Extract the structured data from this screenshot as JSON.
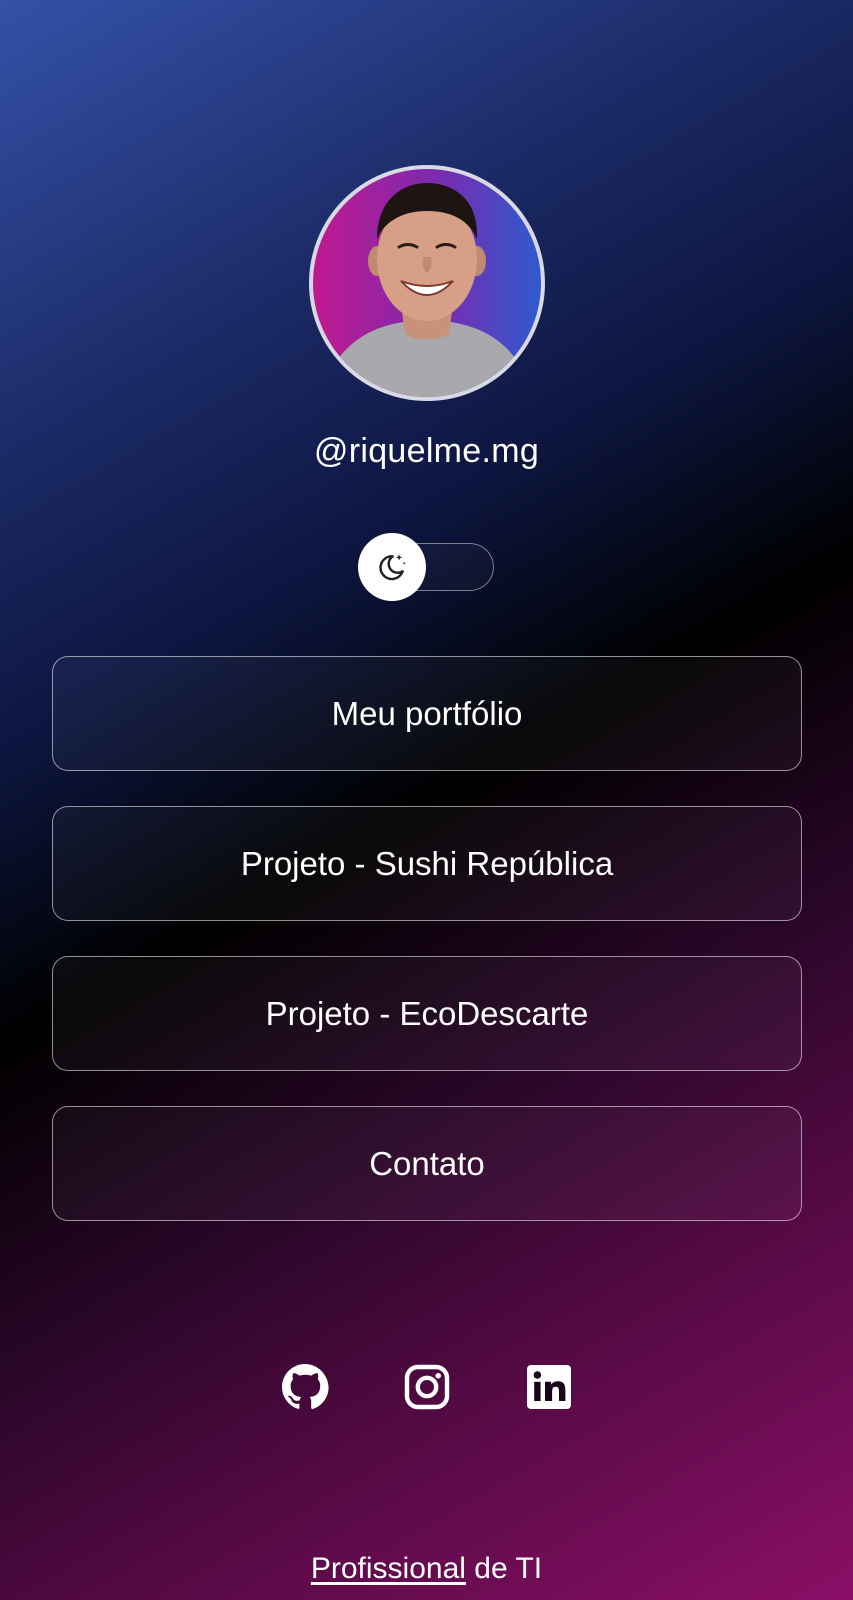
{
  "profile": {
    "handle": "@riquelme.mg",
    "avatar_icon": "profile-photo"
  },
  "theme_toggle": {
    "icon": "moon-stars-icon",
    "mode": "dark"
  },
  "links": [
    {
      "label": "Meu portfólio"
    },
    {
      "label": "Projeto - Sushi República"
    },
    {
      "label": "Projeto - EcoDescarte"
    },
    {
      "label": "Contato"
    }
  ],
  "socials": [
    {
      "icon": "github-icon"
    },
    {
      "icon": "instagram-icon"
    },
    {
      "icon": "linkedin-icon"
    }
  ],
  "footer": {
    "link_text": "Profissional",
    "rest_text": " de TI"
  },
  "colors": {
    "background_top": "#3451a8",
    "background_middle": "#000000",
    "background_bottom": "#8a0f66",
    "avatar_ring": "#d9d9e3"
  }
}
